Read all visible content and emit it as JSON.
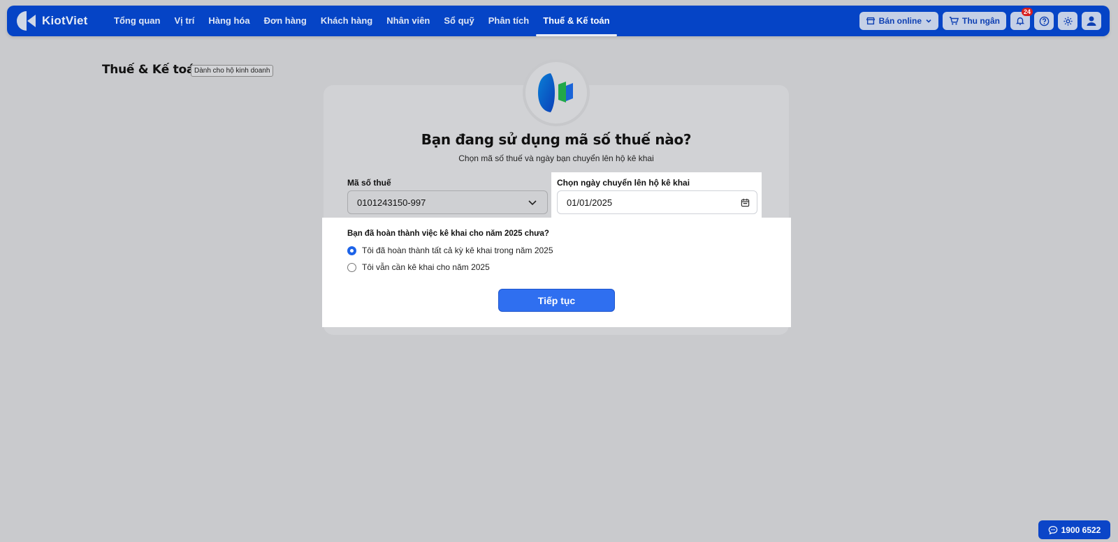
{
  "brand": {
    "name": "KiotViet"
  },
  "nav": {
    "items": [
      {
        "label": "Tổng quan"
      },
      {
        "label": "Vị trí"
      },
      {
        "label": "Hàng hóa"
      },
      {
        "label": "Đơn hàng"
      },
      {
        "label": "Khách hàng"
      },
      {
        "label": "Nhân viên"
      },
      {
        "label": "Sổ quỹ"
      },
      {
        "label": "Phân tích"
      },
      {
        "label": "Thuế & Kế toán",
        "active": true
      }
    ]
  },
  "toolbar": {
    "sell_online": "Bán online",
    "cashier": "Thu ngân",
    "notification_count": "24"
  },
  "page": {
    "title": "Thuế & Kế toán",
    "tag": "Dành cho hộ kinh doanh"
  },
  "form": {
    "heading": "Bạn đang sử dụng mã số thuế nào?",
    "subheading": "Chọn mã số thuế và ngày bạn chuyển lên hộ kê khai",
    "tax_label": "Mã số thuế",
    "tax_value": "0101243150-997",
    "date_label": "Chọn ngày chuyển lên hộ kê khai",
    "date_value": "01/01/2025",
    "question": "Bạn đã hoàn thành việc kê khai cho năm 2025 chưa?",
    "options": [
      {
        "label": "Tôi đã hoàn thành tất cả kỳ kê khai trong năm 2025",
        "checked": true
      },
      {
        "label": "Tôi vẫn cần kê khai cho năm 2025",
        "checked": false
      }
    ],
    "continue_label": "Tiếp tục"
  },
  "hotline": {
    "number": "1900 6522"
  },
  "colors": {
    "nav_bg": "#0544c6",
    "primary_button": "#2f6ff0",
    "radio_checked": "#1d63e8",
    "badge": "#d81f1f",
    "overlay_bg": "#c9cacd"
  }
}
